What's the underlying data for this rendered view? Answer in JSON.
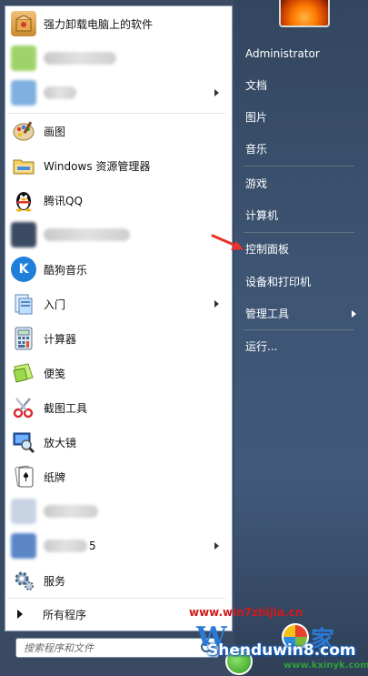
{
  "user_name": "Administrator",
  "right_menu": [
    {
      "label": "文档",
      "has_submenu": false
    },
    {
      "label": "图片",
      "has_submenu": false
    },
    {
      "label": "音乐",
      "has_submenu": false
    },
    {
      "label": "游戏",
      "has_submenu": false
    },
    {
      "label": "计算机",
      "has_submenu": false
    },
    {
      "label": "控制面板",
      "has_submenu": false
    },
    {
      "label": "设备和打印机",
      "has_submenu": false
    },
    {
      "label": "管理工具",
      "has_submenu": true
    },
    {
      "label": "运行...",
      "has_submenu": false
    }
  ],
  "left_menu": {
    "pinned": [
      {
        "label": "强力卸载电脑上的软件",
        "icon": "uninstall-box-icon"
      }
    ],
    "recent": [
      {
        "label": "画图",
        "icon": "paint-palette-icon"
      },
      {
        "label": "Windows 资源管理器",
        "icon": "explorer-folder-icon"
      },
      {
        "label": "腾讯QQ",
        "icon": "qq-penguin-icon"
      },
      {
        "label": "酷狗音乐",
        "icon": "kugou-k-icon"
      },
      {
        "label": "入门",
        "icon": "getting-started-icon"
      },
      {
        "label": "计算器",
        "icon": "calculator-icon"
      },
      {
        "label": "便笺",
        "icon": "sticky-notes-icon"
      },
      {
        "label": "截图工具",
        "icon": "snipping-scissors-icon"
      },
      {
        "label": "放大镜",
        "icon": "magnifier-icon"
      },
      {
        "label": "纸牌",
        "icon": "solitaire-cards-icon"
      },
      {
        "label": "5",
        "icon": "blurred-app-icon"
      },
      {
        "label": "服务",
        "icon": "services-gear-icon"
      }
    ]
  },
  "all_programs_label": "所有程序",
  "search": {
    "placeholder": "搜索程序和文件"
  },
  "watermark": {
    "url": "www.win7zhijia.cn",
    "logo_text": "W",
    "logo_char": "家",
    "brand": "Shenduwin8.com",
    "site": "www.kxinyk.com"
  },
  "colors": {
    "annotation_arrow": "#e8322a",
    "menu_accent": "#2b7bd6"
  }
}
